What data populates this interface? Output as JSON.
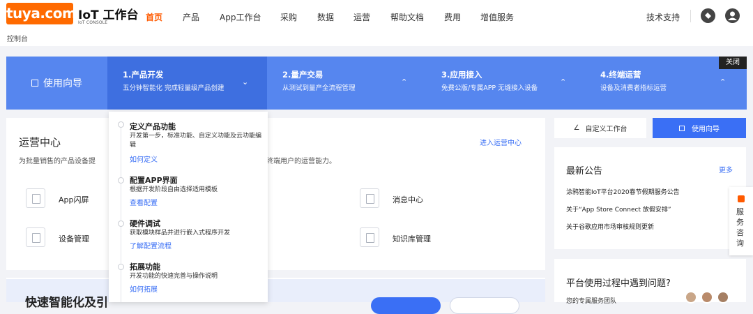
{
  "header": {
    "logo_text": "tuya.com",
    "title": "IoT 工作台",
    "subtitle": "IoT CONSOLE",
    "breadcrumb": "控制台",
    "nav": [
      "首页",
      "产品",
      "App工作台",
      "采购",
      "数据",
      "运营",
      "帮助文档",
      "费用",
      "增值服务"
    ],
    "active_nav": "首页",
    "support": "技术支持"
  },
  "guide": {
    "left_label": "使用向导",
    "close": "关闭",
    "steps": [
      {
        "title": "1.产品开发",
        "desc": "五分钟智能化 完成轻量级产品创建",
        "chevron": "⌄"
      },
      {
        "title": "2.量产交易",
        "desc": "从测试到量产全流程管理",
        "chevron": "⌃"
      },
      {
        "title": "3.应用接入",
        "desc": "免费公版/专属APP 无缝接入设备",
        "chevron": "⌃"
      },
      {
        "title": "4.终端运营",
        "desc": "设备及消费者指标运营",
        "chevron": "⌃"
      }
    ]
  },
  "dropdown": {
    "items": [
      {
        "title": "定义产品功能",
        "desc": "开发第一步，标准功能、自定义功能及云功能编辑",
        "link": "如何定义"
      },
      {
        "title": "配置APP界面",
        "desc": "根据开发阶段自由选择适用模板",
        "link": "查看配置"
      },
      {
        "title": "硬件调试",
        "desc": "获取模块样品并进行嵌入式程序开发",
        "link": "了解配置流程"
      },
      {
        "title": "拓展功能",
        "desc": "开发功能的快速完善与操作说明",
        "link": "如何拓展"
      }
    ]
  },
  "ops": {
    "title": "运营中心",
    "desc_left": "为批量销售的产品设备提",
    "desc_right": "终端用户的运营能力。",
    "link": "进入运营中心",
    "items": [
      "App闪屏",
      "设备管理",
      "消息中心",
      "知识库管理"
    ]
  },
  "right_panel": {
    "custom_btn": "自定义工作台",
    "guide_btn": "使用向导",
    "notice_title": "最新公告",
    "notice_more": "更多",
    "notices": [
      "涂鸦智能IoT平台2020春节假期服务公告",
      "关于“App Store Connect 放假安排”",
      "关于谷歌应用市场审核规则更新"
    ],
    "help_title": "平台使用过程中遇到问题?",
    "help_sub": "您的专属服务团队"
  },
  "float_tab": {
    "text": "服务咨询"
  },
  "promo": {
    "title": "快速智能化及引"
  },
  "colors": {
    "accent": "#ff5a00",
    "guide_bg": "#5686ef",
    "link": "#3a6ff5"
  }
}
